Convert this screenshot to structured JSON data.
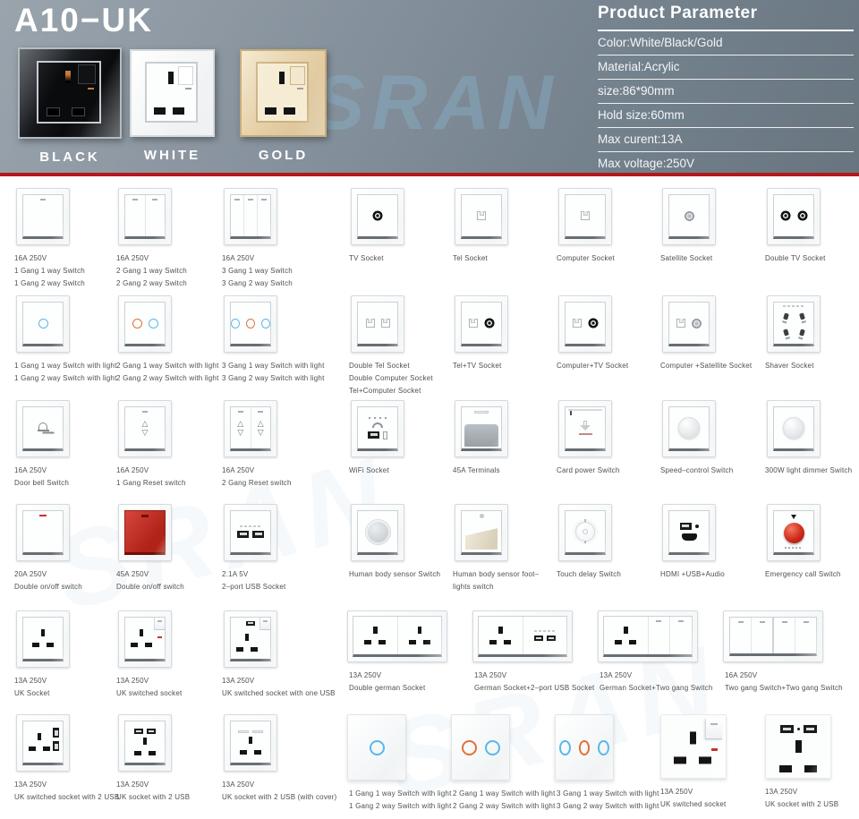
{
  "header": {
    "title": "A10−UK",
    "watermark": "SRAN",
    "variants": [
      {
        "label": "BLACK"
      },
      {
        "label": "WHITE"
      },
      {
        "label": "GOLD"
      }
    ],
    "parameters": {
      "title": "Product Parameter",
      "rows": [
        "Color:White/Black/Gold",
        "Material:Acrylic",
        "size:86*90mm",
        "Hold size:60mm",
        "Max curent:13A",
        "Max voltage:250V"
      ]
    }
  },
  "colors": {
    "accent_red": "#b2191c",
    "touch_blue": "#59b8e8",
    "touch_orange": "#e2703a",
    "header_gray": "#8a95a0"
  },
  "grid": {
    "rows": [
      {
        "items": [
          {
            "glyph": "switch-1gang",
            "lines": [
              "16A 250V",
              "1 Gang 1 way Switch",
              "1 Gang 2 way Switch"
            ]
          },
          {
            "glyph": "switch-2gang",
            "lines": [
              "16A 250V",
              "2 Gang 1 way Switch",
              "2 Gang 2 way Switch"
            ]
          },
          {
            "glyph": "switch-3gang",
            "lines": [
              "16A 250V",
              "3 Gang 1 way Switch",
              "3 Gang 2 way Switch"
            ]
          },
          {
            "glyph": "tv-socket",
            "lines": [
              "TV Socket"
            ]
          },
          {
            "glyph": "tel-socket",
            "lines": [
              "Tel Socket"
            ]
          },
          {
            "glyph": "computer-socket",
            "lines": [
              "Computer Socket"
            ]
          },
          {
            "glyph": "satellite-socket",
            "lines": [
              "Satellite Socket"
            ]
          },
          {
            "glyph": "double-tv-socket",
            "lines": [
              "Double TV Socket"
            ]
          }
        ]
      },
      {
        "items": [
          {
            "glyph": "touch-switch-1gang",
            "lines": [
              "1 Gang 1 way Switch with light",
              "1 Gang 2 way Switch with light"
            ]
          },
          {
            "glyph": "touch-switch-2gang",
            "lines": [
              "2 Gang 1 way Switch with light",
              "2 Gang 2 way Switch with light"
            ]
          },
          {
            "glyph": "touch-switch-3gang",
            "lines": [
              "3 Gang 1 way Switch with light",
              "3 Gang 2 way Switch with light"
            ]
          },
          {
            "glyph": "double-jack-socket",
            "lines": [
              "Double Tel Socket",
              "Double Computer Socket",
              "Tel+Computer Socket"
            ]
          },
          {
            "glyph": "tel-tv-socket",
            "lines": [
              "Tel+TV Socket"
            ]
          },
          {
            "glyph": "computer-tv-socket",
            "lines": [
              "Computer+TV Socket"
            ]
          },
          {
            "glyph": "computer-satellite-socket",
            "lines": [
              "Computer +Satellite Socket"
            ]
          },
          {
            "glyph": "shaver-socket",
            "lines": [
              "Shaver Socket"
            ]
          }
        ]
      },
      {
        "items": [
          {
            "glyph": "doorbell-switch",
            "lines": [
              "16A 250V",
              "Door bell Switch"
            ]
          },
          {
            "glyph": "reset-switch-1gang",
            "lines": [
              "16A 250V",
              "1 Gang Reset switch"
            ]
          },
          {
            "glyph": "reset-switch-2gang",
            "lines": [
              "16A 250V",
              "2 Gang Reset switch"
            ]
          },
          {
            "glyph": "wifi-socket",
            "lines": [
              "WiFi Socket"
            ]
          },
          {
            "glyph": "terminals-45a",
            "lines": [
              "45A Terminals"
            ]
          },
          {
            "glyph": "card-power-switch",
            "lines": [
              "Card power Switch"
            ]
          },
          {
            "glyph": "speed-control-knob",
            "lines": [
              "Speed–control Switch"
            ]
          },
          {
            "glyph": "dimmer-knob",
            "lines": [
              "300W light dimmer Switch"
            ]
          }
        ]
      },
      {
        "items": [
          {
            "glyph": "neon-rocker-switch",
            "lines": [
              "20A 250V",
              "Double on/off switch"
            ]
          },
          {
            "glyph": "red-rocker-switch",
            "lines": [
              "45A 250V",
              "Double on/off switch"
            ]
          },
          {
            "glyph": "usb-2port-socket",
            "lines": [
              "2.1A 5V",
              "2–port USB Socket"
            ]
          },
          {
            "glyph": "pir-sensor-switch",
            "lines": [
              "Human body sensor Switch"
            ]
          },
          {
            "glyph": "foot-light-sensor",
            "lines": [
              "Human body sensor foot–",
              "lights switch"
            ]
          },
          {
            "glyph": "touch-delay-switch",
            "lines": [
              "Touch delay Switch"
            ]
          },
          {
            "glyph": "hdmi-usb-audio-socket",
            "lines": [
              "HDMI +USB+Audio"
            ]
          },
          {
            "glyph": "emergency-call-switch",
            "lines": [
              "Emergency call Switch"
            ]
          }
        ]
      },
      {
        "items": [
          {
            "glyph": "uk-socket",
            "lines": [
              "13A 250V",
              "UK Socket"
            ]
          },
          {
            "glyph": "uk-switched-socket",
            "lines": [
              "13A 250V",
              "UK switched socket"
            ]
          },
          {
            "glyph": "uk-switched-socket-usb",
            "lines": [
              "13A 250V",
              "UK switched socket with one USB"
            ]
          },
          {
            "glyph": "double-german-socket",
            "lines": [
              "13A 250V",
              "Double german Socket"
            ]
          },
          {
            "glyph": "german-socket-usb",
            "lines": [
              "13A 250V",
              "German Socket+2–port USB Socket"
            ]
          },
          {
            "glyph": "german-socket-2gang",
            "lines": [
              "13A 250V",
              "German Socket+Two gang Switch"
            ]
          },
          {
            "glyph": "two-gang-two-gang",
            "lines": [
              "16A 250V",
              "Two gang Switch+Two gang Switch"
            ]
          }
        ]
      },
      {
        "items": [
          {
            "glyph": "uk-switched-socket-2usb",
            "lines": [
              "13A 250V",
              "UK switched socket with 2 USB"
            ]
          },
          {
            "glyph": "uk-socket-2usb",
            "lines": [
              "13A 250V",
              "UK socket with 2 USB"
            ]
          },
          {
            "glyph": "uk-socket-2usb-cover",
            "lines": [
              "13A 250V",
              "UK socket with 2 USB (with cover)"
            ]
          },
          {
            "glyph": "touch-panel-1gang",
            "lines": [
              "1 Gang 1 way Switch with light",
              "1 Gang 2 way Switch with light"
            ]
          },
          {
            "glyph": "touch-panel-2gang",
            "lines": [
              "2 Gang 1 way Switch with light",
              "2 Gang 2 way Switch with light"
            ]
          },
          {
            "glyph": "touch-panel-3gang",
            "lines": [
              "3 Gang 1 way Switch with light",
              "3 Gang 2 way Switch with light"
            ]
          },
          {
            "glyph": "uk-switched-socket-closeup",
            "lines": [
              "13A 250V",
              "UK switched socket"
            ]
          },
          {
            "glyph": "uk-socket-2usb-closeup",
            "lines": [
              "13A 250V",
              "UK socket with 2 USB"
            ]
          }
        ]
      }
    ]
  }
}
